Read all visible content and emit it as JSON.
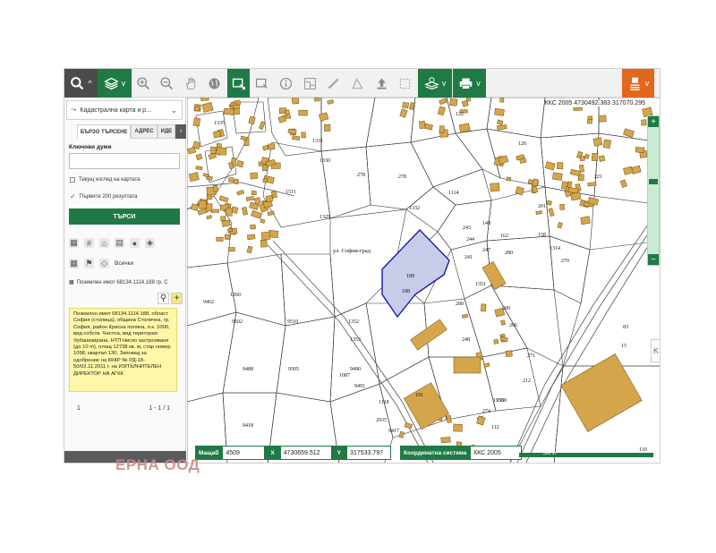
{
  "toolbar": {
    "tools": [
      "search-icon",
      "layers-icon",
      "zoom-in-icon",
      "zoom-out-icon",
      "hand-pan-icon",
      "globe-icon",
      "select-rect-icon",
      "export-rect-icon",
      "info-icon",
      "profile-icon",
      "measure-line-icon",
      "measure-area-icon",
      "upload-icon",
      "clear-selection-icon",
      "layers-visibility-icon",
      "print-icon",
      "menu-icon"
    ],
    "menu_badge": "0"
  },
  "sidebar": {
    "layer_select": "Кадастрална карта и р...",
    "tabs": [
      "БЪРЗО ТЪРСЕНЕ",
      "АДРЕС",
      "ИДЕ"
    ],
    "keywords_label": "Ключови думи",
    "keywords_value": "",
    "current_view_label": "Текущ изглед на картата",
    "first_results_label": "Първите 200 резултата",
    "search_button": "ТЪРСИ",
    "objects_label": "Всички",
    "result_title": "Поземлен имот 68134.1114.188 гр. С",
    "result_note": "Поземлен имот 68134.1114.188, област София (столица), община Столична, гр. София, район Красна поляна, п.к. 1000, вид собств. Частна, вид територия Урбанизирана, НТП Ниско застрояване (до 10 m), площ 12738 кв. м, стар номер 1098, квартал 130, Заповед за одобрение на КККР № РД-18-50/02.11.2011 г. на ИЗПЪЛНИТЕЛЕН ДИРЕКТОР НА АГКК",
    "pager_page": "1",
    "pager_count": "1 - 1 / 1"
  },
  "map": {
    "header_info": "ККС 2005 4730492.383  317070.295",
    "selected_parcel": "188",
    "labels": [
      "1335",
      "1331",
      "1330",
      "122",
      "1511",
      "278",
      "1329",
      "1332",
      "140",
      "162",
      "158",
      "1314",
      "201",
      "243",
      "244",
      "247",
      "241",
      "1351",
      "1260",
      "9502",
      "9510",
      "188",
      "1352",
      "1353",
      "9505",
      "1087",
      "9490",
      "9491",
      "1118",
      "2035",
      "1358",
      "191",
      "248",
      "206",
      "200",
      "110",
      "83",
      "9462",
      "9488",
      "9418",
      "9417",
      "280",
      "270",
      "15",
      "271",
      "1114",
      "274",
      "212",
      "112",
      "278",
      "120",
      "221",
      "200",
      "1358"
    ],
    "street_label": "ул. София-град"
  },
  "coordbar": {
    "scale_label": "Мащаб",
    "scale_value": "4509",
    "x_label": "X",
    "x_value": "4730659.512",
    "y_label": "Y",
    "y_value": "317533.797",
    "cs_label": "Координатна система",
    "cs_value": "ККС 2005",
    "scalebar_text": "300 m"
  },
  "watermark": "ЕРНА ООД",
  "colors": {
    "accent": "#1f7a45",
    "dark": "#4b4b4b",
    "orange": "#e2671c",
    "building": "#d4a54a",
    "selected_parcel": "#c9cce8",
    "note_bg": "#fff7a8"
  }
}
